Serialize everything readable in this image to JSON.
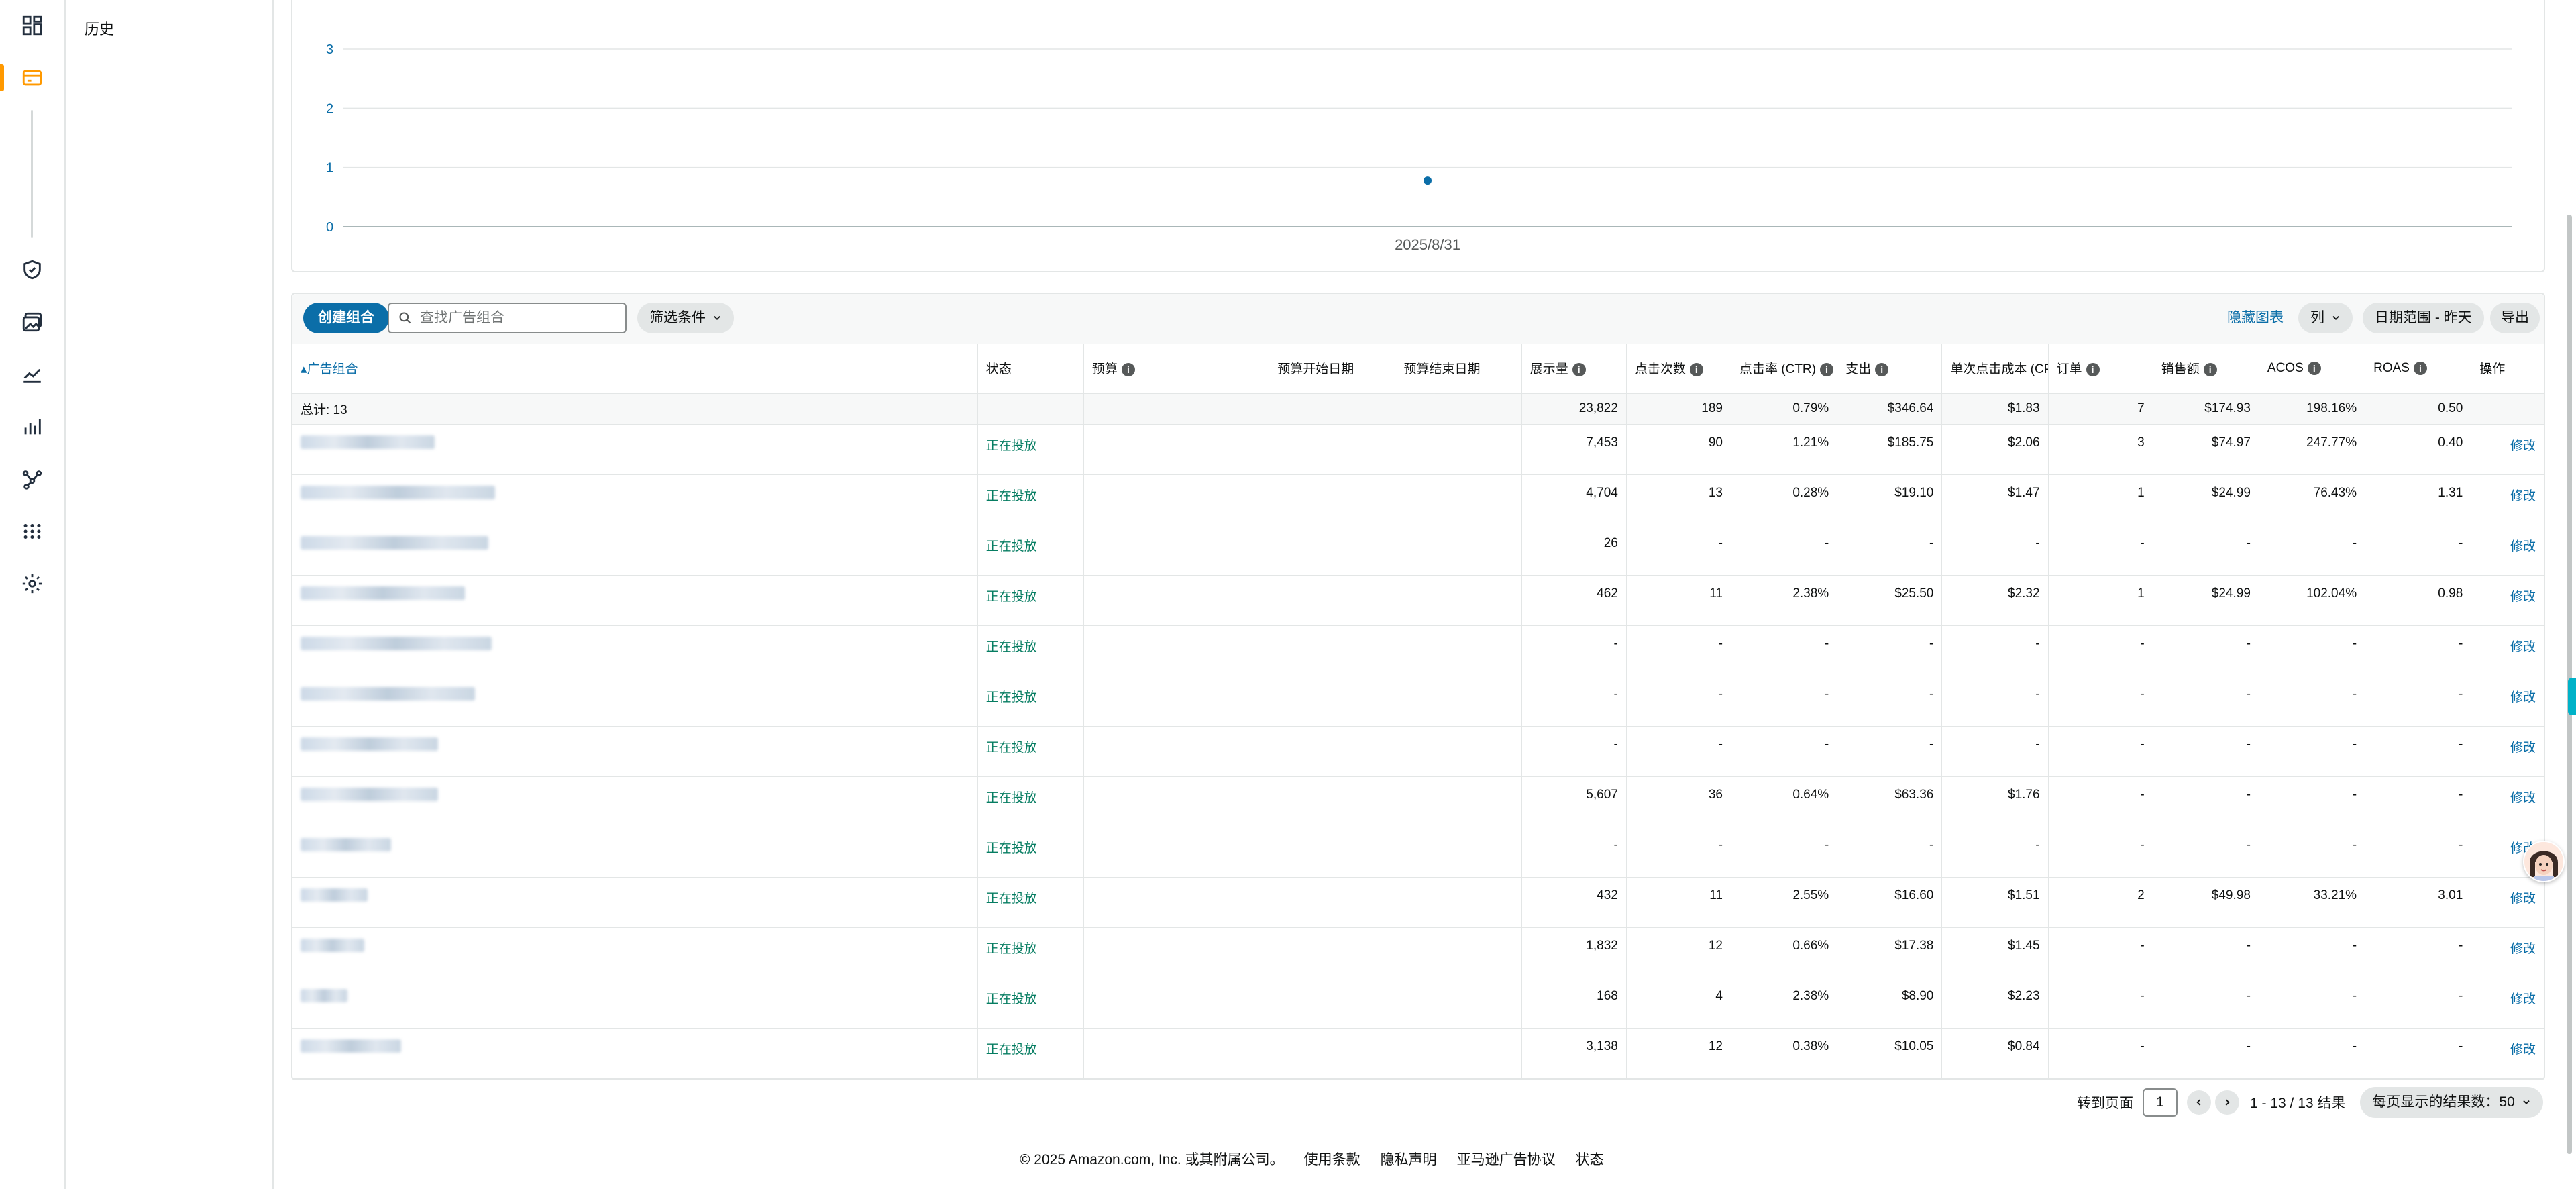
{
  "nav": {
    "history_label": "历史"
  },
  "colors": {
    "accent_orange": "#ff9900",
    "link_blue": "#0b6ea8",
    "status_green": "#067d62"
  },
  "chart_data": {
    "type": "line",
    "title": "",
    "xlabel": "",
    "ylabel": "",
    "ylim": [
      0,
      3
    ],
    "y_ticks": [
      "3",
      "2",
      "1",
      "0"
    ],
    "categories": [
      "2025/8/31"
    ],
    "series": [
      {
        "values": [
          0.78
        ]
      }
    ],
    "grid": true,
    "legend": "none"
  },
  "toolbar": {
    "create_label": "创建组合",
    "search_placeholder": "查找广告组合",
    "filter_label": "筛选条件",
    "hide_chart_label": "隐藏图表",
    "columns_label": "列",
    "date_range_label": "日期范围 - 昨天",
    "export_label": "导出"
  },
  "table": {
    "headers": {
      "portfolio": "广告组合",
      "status": "状态",
      "budget": "预算",
      "budget_start": "预算开始日期",
      "budget_end": "预算结束日期",
      "impressions": "展示量",
      "clicks": "点击次数",
      "ctr": "点击率 (CTR)",
      "spend": "支出",
      "cpc": "单次点击成本 (CPC)",
      "orders": "订单",
      "sales": "销售额",
      "acos": "ACOS",
      "roas": "ROAS",
      "actions": "操作"
    },
    "total": {
      "label": "总计: 13",
      "impressions": "23,822",
      "clicks": "189",
      "ctr": "0.79%",
      "spend": "$346.64",
      "cpc": "$1.83",
      "orders": "7",
      "sales": "$174.93",
      "acos": "198.16%",
      "roas": "0.50"
    },
    "rows": [
      {
        "status": "正在投放",
        "impressions": "7,453",
        "clicks": "90",
        "ctr": "1.21%",
        "spend": "$185.75",
        "cpc": "$2.06",
        "orders": "3",
        "sales": "$74.97",
        "acos": "247.77%",
        "roas": "0.40",
        "action": "修改"
      },
      {
        "status": "正在投放",
        "impressions": "4,704",
        "clicks": "13",
        "ctr": "0.28%",
        "spend": "$19.10",
        "cpc": "$1.47",
        "orders": "1",
        "sales": "$24.99",
        "acos": "76.43%",
        "roas": "1.31",
        "action": "修改"
      },
      {
        "status": "正在投放",
        "impressions": "26",
        "clicks": "-",
        "ctr": "-",
        "spend": "-",
        "cpc": "-",
        "orders": "-",
        "sales": "-",
        "acos": "-",
        "roas": "-",
        "action": "修改"
      },
      {
        "status": "正在投放",
        "impressions": "462",
        "clicks": "11",
        "ctr": "2.38%",
        "spend": "$25.50",
        "cpc": "$2.32",
        "orders": "1",
        "sales": "$24.99",
        "acos": "102.04%",
        "roas": "0.98",
        "action": "修改"
      },
      {
        "status": "正在投放",
        "impressions": "-",
        "clicks": "-",
        "ctr": "-",
        "spend": "-",
        "cpc": "-",
        "orders": "-",
        "sales": "-",
        "acos": "-",
        "roas": "-",
        "action": "修改"
      },
      {
        "status": "正在投放",
        "impressions": "-",
        "clicks": "-",
        "ctr": "-",
        "spend": "-",
        "cpc": "-",
        "orders": "-",
        "sales": "-",
        "acos": "-",
        "roas": "-",
        "action": "修改"
      },
      {
        "status": "正在投放",
        "impressions": "-",
        "clicks": "-",
        "ctr": "-",
        "spend": "-",
        "cpc": "-",
        "orders": "-",
        "sales": "-",
        "acos": "-",
        "roas": "-",
        "action": "修改"
      },
      {
        "status": "正在投放",
        "impressions": "5,607",
        "clicks": "36",
        "ctr": "0.64%",
        "spend": "$63.36",
        "cpc": "$1.76",
        "orders": "-",
        "sales": "-",
        "acos": "-",
        "roas": "-",
        "action": "修改"
      },
      {
        "status": "正在投放",
        "impressions": "-",
        "clicks": "-",
        "ctr": "-",
        "spend": "-",
        "cpc": "-",
        "orders": "-",
        "sales": "-",
        "acos": "-",
        "roas": "-",
        "action": "修改"
      },
      {
        "status": "正在投放",
        "impressions": "432",
        "clicks": "11",
        "ctr": "2.55%",
        "spend": "$16.60",
        "cpc": "$1.51",
        "orders": "2",
        "sales": "$49.98",
        "acos": "33.21%",
        "roas": "3.01",
        "action": "修改"
      },
      {
        "status": "正在投放",
        "impressions": "1,832",
        "clicks": "12",
        "ctr": "0.66%",
        "spend": "$17.38",
        "cpc": "$1.45",
        "orders": "-",
        "sales": "-",
        "acos": "-",
        "roas": "-",
        "action": "修改"
      },
      {
        "status": "正在投放",
        "impressions": "168",
        "clicks": "4",
        "ctr": "2.38%",
        "spend": "$8.90",
        "cpc": "$2.23",
        "orders": "-",
        "sales": "-",
        "acos": "-",
        "roas": "-",
        "action": "修改"
      },
      {
        "status": "正在投放",
        "impressions": "3,138",
        "clicks": "12",
        "ctr": "0.38%",
        "spend": "$10.05",
        "cpc": "$0.84",
        "orders": "-",
        "sales": "-",
        "acos": "-",
        "roas": "-",
        "action": "修改"
      }
    ]
  },
  "pagination": {
    "goto_label": "转到页面",
    "page_value": "1",
    "range_label": "1 - 13 / 13 结果",
    "per_page_label": "每页显示的结果数：50"
  },
  "footer": {
    "copyright": "© 2025 Amazon.com, Inc. 或其附属公司。",
    "terms": "使用条款",
    "privacy": "隐私声明",
    "ad_agreement": "亚马逊广告协议",
    "status": "状态"
  }
}
